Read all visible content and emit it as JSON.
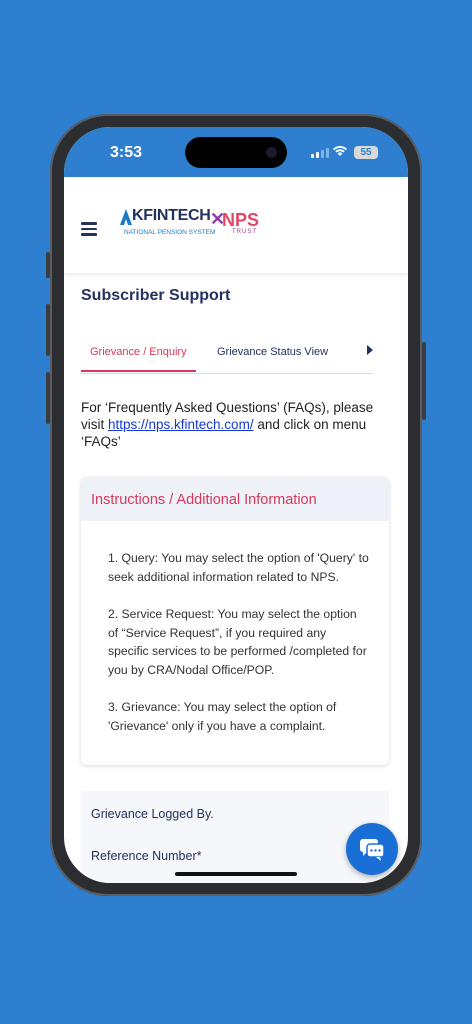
{
  "status_bar": {
    "time": "3:53",
    "battery": "55"
  },
  "header": {
    "logo_kfintech": "KFINTECH",
    "logo_tagline": "NATIONAL PENSION SYSTEM",
    "logo_nps": "NPS",
    "logo_trust": "TRUST"
  },
  "page": {
    "title": "Subscriber Support"
  },
  "tabs": [
    {
      "label": "Grievance / Enquiry",
      "active": true
    },
    {
      "label": "Grievance Status View",
      "active": false
    }
  ],
  "faq": {
    "before": "For ‘Frequently Asked Questions’ (FAQs), please visit ",
    "link": "https://nps.kfintech.com/",
    "after": " and click on menu ‘FAQs’"
  },
  "instructions": {
    "heading": "Instructions / Additional Information",
    "items": [
      "1. Query: You may select the option of 'Query' to seek additional information related to NPS.",
      "2. Service Request: You may select the option of “Service Request”, if you required any specific services to be performed /completed for you by CRA/Nodal Office/POP.",
      "3. Grievance: You may select the option of 'Grievance' only if you have a complaint."
    ]
  },
  "form": {
    "logged_by_label": "Grievance Logged By.",
    "reference_label": "Reference Number*"
  },
  "colors": {
    "accent": "#d6395b",
    "navy": "#23325e",
    "background": "#2f7fd0"
  },
  "icons": {
    "menu": "hamburger-icon",
    "chat": "chat-icon",
    "tab_next": "chevron-right-icon"
  }
}
